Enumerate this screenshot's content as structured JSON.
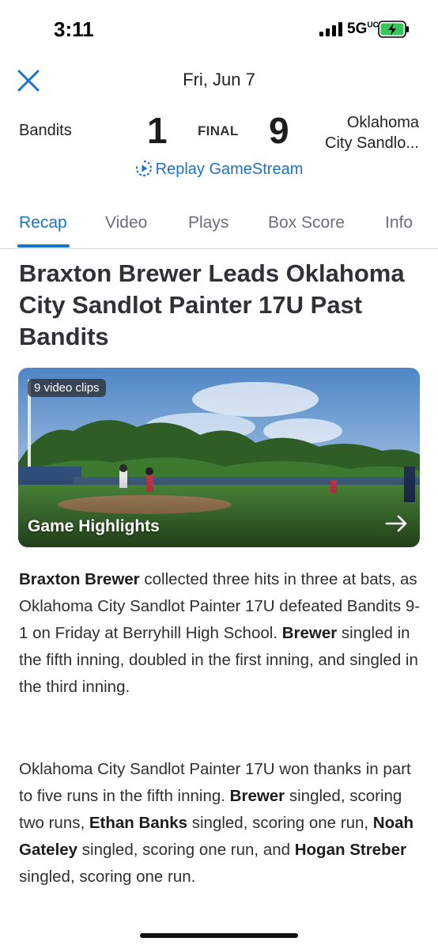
{
  "status_bar": {
    "time": "3:11",
    "network": "5G",
    "network_suffix": "UC",
    "battery_color": "#34c759"
  },
  "header": {
    "close_icon": "close-icon",
    "date": "Fri, Jun 7",
    "away_team": "Bandits",
    "away_score": "1",
    "status": "FINAL",
    "home_score": "9",
    "home_team_line1": "Oklahoma",
    "home_team_line2": "City Sandlo...",
    "replay_label": "Replay GameStream",
    "accent_color": "#1a73c8"
  },
  "tabs": [
    {
      "label": "Recap",
      "active": true
    },
    {
      "label": "Video",
      "active": false
    },
    {
      "label": "Plays",
      "active": false
    },
    {
      "label": "Box Score",
      "active": false
    },
    {
      "label": "Info",
      "active": false
    }
  ],
  "article": {
    "title": "Braxton Brewer Leads Oklahoma City Sandlot Painter 17U Past Bandits",
    "video": {
      "badge": "9 video clips",
      "label": "Game Highlights",
      "arrow_icon": "arrow-right-icon"
    },
    "p1": {
      "name": "Braxton Brewer",
      "text_a": " collected three hits in three at bats, as Oklahoma City Sandlot Painter 17U defeated Bandits 9-1 on Friday at Berryhill High School. ",
      "name2": "Brewer",
      "text_b": " singled in the fifth inning, doubled in the first inning, and singled in the third inning."
    },
    "p2": {
      "text_a": "Oklahoma City Sandlot Painter 17U won thanks in part to five runs in the fifth inning.  ",
      "name1": "Brewer",
      "text_b": " singled, scoring two runs, ",
      "name2": "Ethan Banks",
      "text_c": " singled, scoring one run, ",
      "name3": "Noah Gateley",
      "text_d": " singled, scoring one run, and ",
      "name4": "Hogan Streber",
      "text_e": " singled, scoring one run."
    }
  }
}
